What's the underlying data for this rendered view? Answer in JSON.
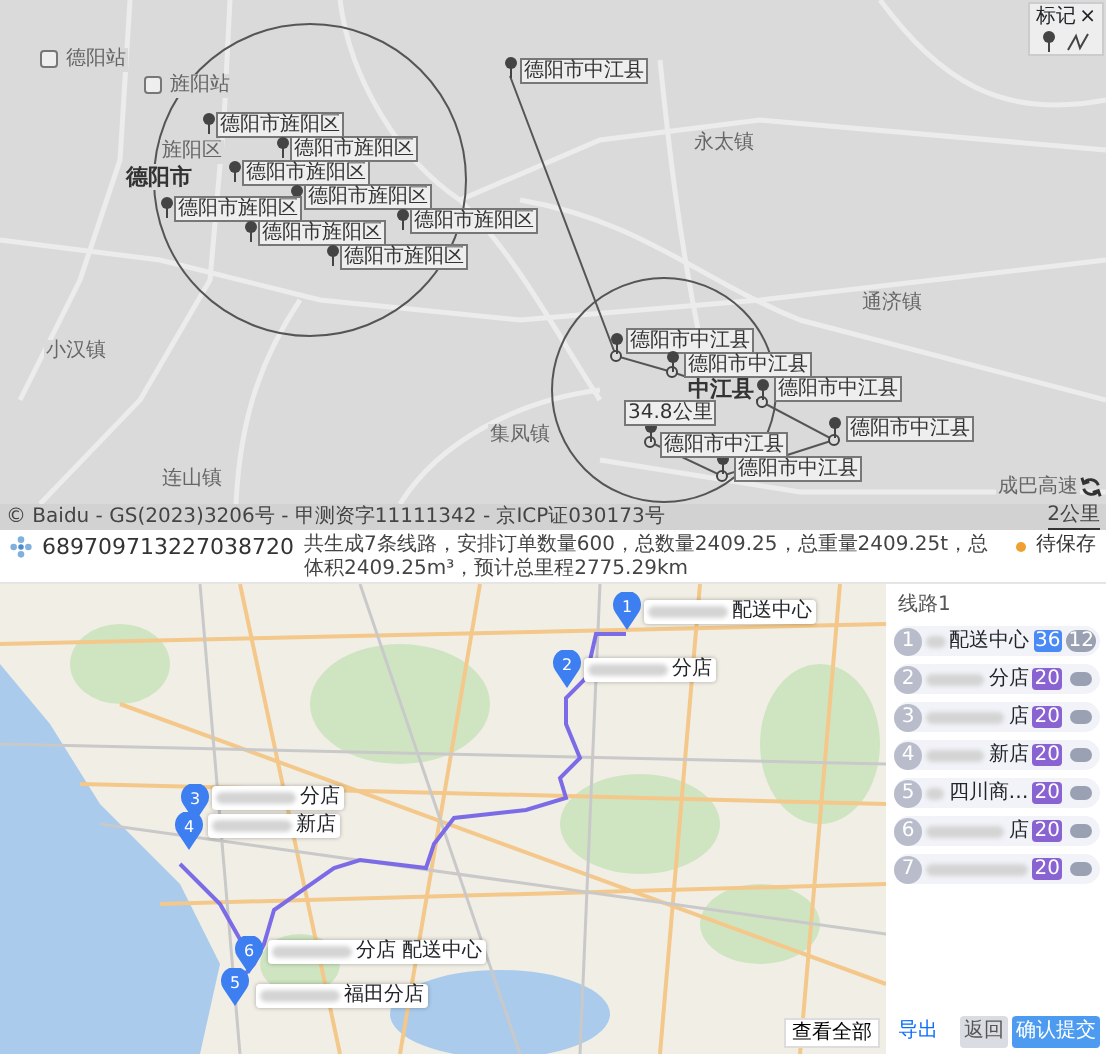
{
  "top_map": {
    "legend": {
      "title": "标记",
      "close": "×"
    },
    "place_names": [
      {
        "text": "德阳市",
        "kind": "city"
      },
      {
        "text": "旌阳区",
        "kind": "town"
      },
      {
        "text": "中江县",
        "kind": "city"
      },
      {
        "text": "永太镇",
        "kind": "town"
      },
      {
        "text": "通济镇",
        "kind": "town"
      },
      {
        "text": "集凤镇",
        "kind": "town"
      },
      {
        "text": "连山镇",
        "kind": "town"
      },
      {
        "text": "小汉镇",
        "kind": "town"
      },
      {
        "text": "成巴高速",
        "kind": "road"
      },
      {
        "text": "德阳站",
        "kind": "station"
      },
      {
        "text": "旌阳站",
        "kind": "station"
      }
    ],
    "start_marker": {
      "label": "德阳市中江县"
    },
    "circle_markers": [
      {
        "label": "德阳市旌阳区"
      },
      {
        "label": "德阳市旌阳区"
      },
      {
        "label": "德阳市旌阳区"
      },
      {
        "label": "德阳市旌阳区"
      },
      {
        "label": "德阳市旌阳区"
      },
      {
        "label": "德阳市旌阳区"
      },
      {
        "label": "德阳市旌阳区"
      },
      {
        "label": "德阳市旌阳区"
      }
    ],
    "route_markers": [
      {
        "label": "德阳市中江县"
      },
      {
        "label": "德阳市中江县"
      },
      {
        "label": "德阳市中江县"
      },
      {
        "label": "德阳市中江县"
      },
      {
        "label": "德阳市中江县"
      },
      {
        "label": "德阳市中江县"
      }
    ],
    "distance_label": "34.8公里",
    "attribution": "© Baidu - GS(2023)3206号 - 甲测资字11111342 - 京ICP证030173号",
    "scale": "2公里"
  },
  "summary": {
    "order_id": "689709713227038720",
    "text": "共生成7条线路，安排订单数量600，总数量2409.25，总重量2409.25t，总体积2409.25m³，预计总里程2775.29km",
    "status": "待保存"
  },
  "route_map": {
    "stops": [
      {
        "number": "1",
        "suffix": "配送中心"
      },
      {
        "number": "2",
        "suffix": "分店"
      },
      {
        "number": "3",
        "suffix": "分店"
      },
      {
        "number": "4",
        "suffix": "新店"
      },
      {
        "number": "6",
        "suffix": "分店 配送中心"
      },
      {
        "number": "5",
        "suffix": "福田分店"
      }
    ],
    "view_all": "查看全部"
  },
  "sidebar": {
    "title": "线路1",
    "items": [
      {
        "number": "1",
        "suffix": "配送中心",
        "tag": "36",
        "color": "#4a8af4",
        "count": "12"
      },
      {
        "number": "2",
        "suffix": "分店",
        "tag": "20",
        "color": "#8a63d2"
      },
      {
        "number": "3",
        "suffix": "店",
        "tag": "20",
        "color": "#8a63d2"
      },
      {
        "number": "4",
        "suffix": "新店",
        "tag": "20",
        "color": "#8a63d2"
      },
      {
        "number": "5",
        "suffix": "四川商…",
        "tag": "20",
        "color": "#8a63d2"
      },
      {
        "number": "6",
        "suffix": "店",
        "tag": "20",
        "color": "#8a63d2"
      },
      {
        "number": "7",
        "tag": "20",
        "color": "#8a63d2"
      }
    ],
    "buttons": [
      {
        "label": "导出",
        "kind": "link"
      },
      {
        "label": "返回",
        "kind": "secondary"
      },
      {
        "label": "确认提交",
        "kind": "primary"
      }
    ]
  }
}
